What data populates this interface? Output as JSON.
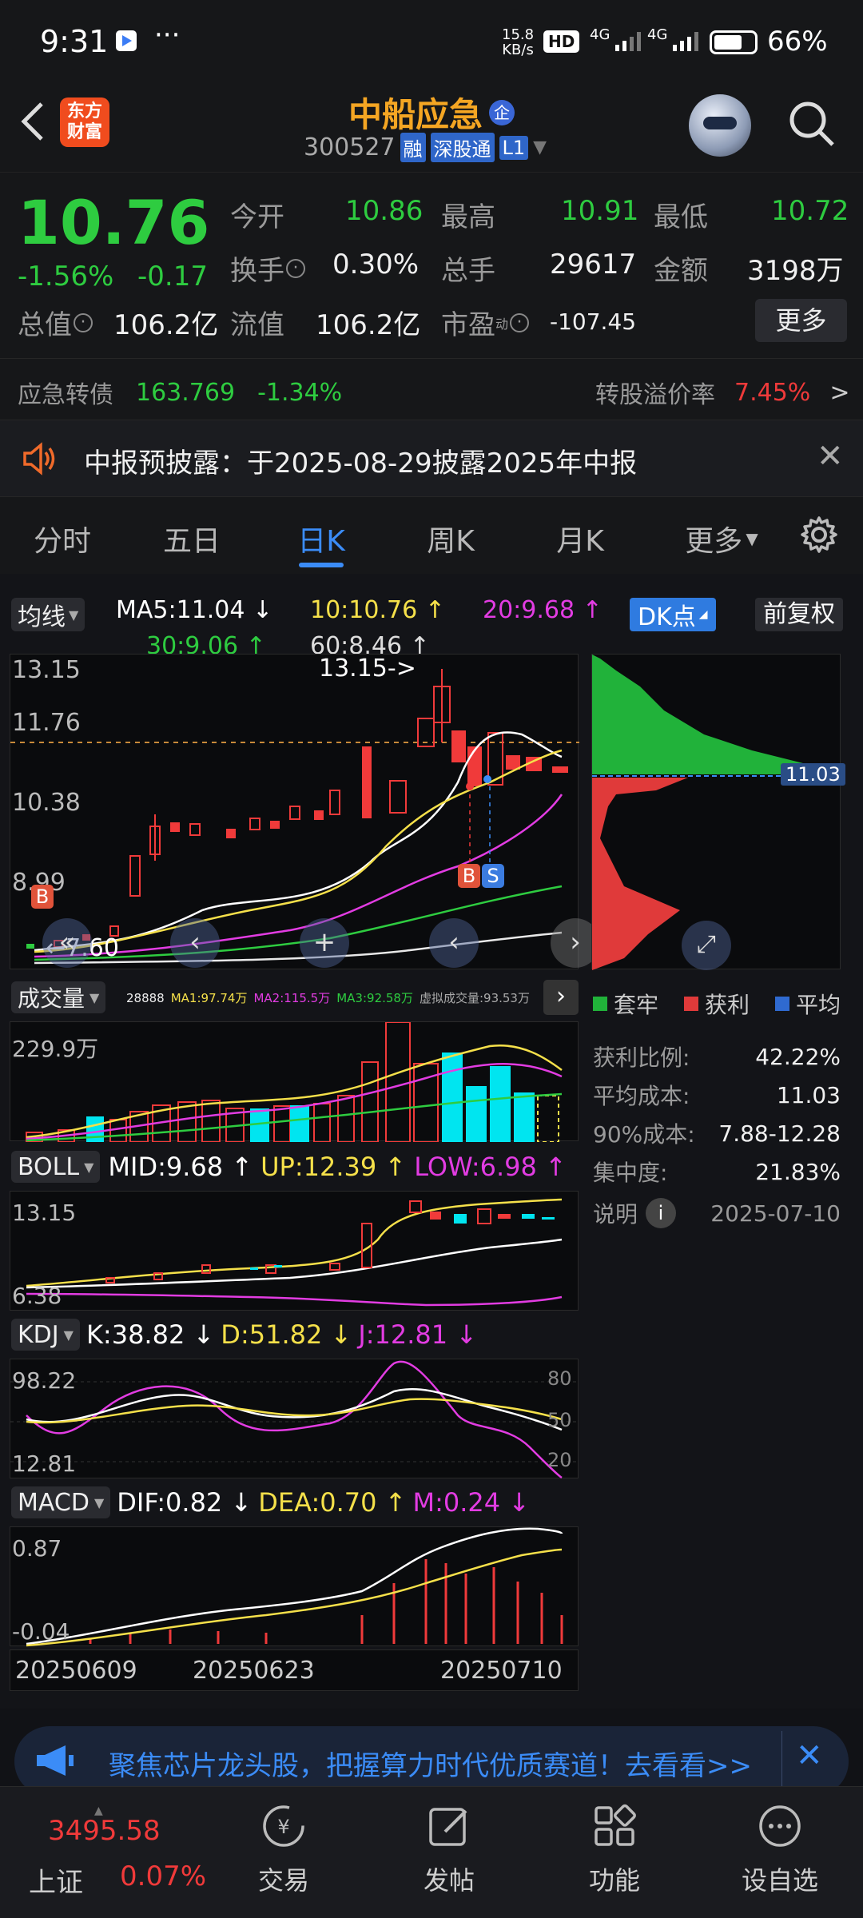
{
  "status_bar": {
    "time": "9:31",
    "net_speed_top": "15.8",
    "net_speed_unit": "KB/s",
    "hd": "HD",
    "sig1": "4G",
    "sig2": "4G",
    "battery": "66%",
    "dots": "···"
  },
  "header": {
    "brand_line1": "东方",
    "brand_line2": "财富",
    "title": "中船应急",
    "title_badge": "企",
    "code": "300527",
    "tag_rong": "融",
    "tag_connect": "深股通",
    "tag_level": "L1"
  },
  "quote": {
    "price": "10.76",
    "change_pct": "-1.56%",
    "change_amt": "-0.17",
    "open_label": "今开",
    "open": "10.86",
    "high_label": "最高",
    "high": "10.91",
    "low_label": "最低",
    "low": "10.72",
    "turnover_label": "换手",
    "turnover": "0.30%",
    "volume_label": "总手",
    "volume": "29617",
    "amount_label": "金额",
    "amount": "3198万",
    "mcap_label": "总值",
    "mcap": "106.2亿",
    "float_label": "流值",
    "float": "106.2亿",
    "pe_label": "市盈",
    "pe_sup": "动",
    "pe": "-107.45",
    "more_button": "更多",
    "bond_label": "应急转债",
    "bond_price": "163.769",
    "bond_change": "-1.34%",
    "premium_label": "转股溢价率",
    "premium": "7.45%"
  },
  "notice": {
    "text": "中报预披露：于2025-08-29披露2025年中报"
  },
  "tabs": [
    "分时",
    "五日",
    "日K",
    "周K",
    "月K",
    "更多"
  ],
  "active_tab": "日K",
  "kline": {
    "selector": "均线",
    "ma5": "MA5:11.04",
    "ma10": "10:10.76",
    "ma20": "20:9.68",
    "ma30": "30:9.06",
    "ma60": "60:8.46",
    "dk_button": "DK点",
    "adjust_button": "前复权",
    "y_top": "13.15",
    "y_mid": "11.76",
    "y_low": "10.38",
    "y_bot": "8.99",
    "y_min": "7.60",
    "peak_label": "13.15->",
    "min_label": "←7.60",
    "b_marker": "B",
    "s_marker": "S"
  },
  "chip": {
    "price_tag": "11.03",
    "legend": [
      "套牢",
      "获利",
      "平均"
    ],
    "rows": [
      {
        "label": "获利比例:",
        "value": "42.22%"
      },
      {
        "label": "平均成本:",
        "value": "11.03"
      },
      {
        "label": "90%成本:",
        "value": "7.88-12.28"
      },
      {
        "label": "集中度:",
        "value": "21.83%"
      }
    ],
    "note_label": "说明",
    "date": "2025-07-10"
  },
  "volume": {
    "selector": "成交量",
    "v0": "28888",
    "ma1": "MA1:97.74万",
    "ma2": "MA2:115.5万",
    "ma3": "MA3:92.58万",
    "virtual": "虚拟成交量:93.53万",
    "y_top": "229.9万"
  },
  "boll": {
    "selector": "BOLL",
    "mid": "MID:9.68",
    "up": "UP:12.39",
    "low": "LOW:6.98",
    "y_top": "13.15",
    "y_bot": "6.38"
  },
  "kdj": {
    "selector": "KDJ",
    "k": "K:38.82",
    "d": "D:51.82",
    "j": "J:12.81",
    "y_top": "98.22",
    "y_bot": "12.81",
    "g80": "80",
    "g50": "50",
    "g20": "20"
  },
  "macd": {
    "selector": "MACD",
    "dif": "DIF:0.82",
    "dea": "DEA:0.70",
    "m": "M:0.24",
    "y_top": "0.87",
    "y_bot": "-0.04"
  },
  "dates": [
    "20250609",
    "20250623",
    "20250710"
  ],
  "ad": {
    "text": "聚焦芯片龙头股，把握算力时代优质赛道！去看看>>"
  },
  "bottom": {
    "index_value": "3495.58",
    "index_name": "上证",
    "index_change": "0.07%",
    "items": [
      "交易",
      "发帖",
      "功能",
      "设自选"
    ]
  },
  "colors": {
    "up": "#f03a3a",
    "down": "#2ecc40",
    "accent_blue": "#2f7be0",
    "ma10_yellow": "#f5e04a",
    "ma20_magenta": "#e23ce2",
    "cyan_bar": "#00e5f0"
  }
}
